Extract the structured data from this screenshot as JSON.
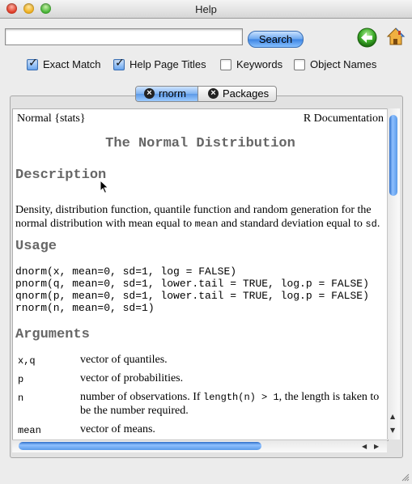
{
  "window": {
    "title": "Help"
  },
  "search": {
    "value": "",
    "button_label": "Search"
  },
  "options": [
    {
      "label": "Exact Match",
      "checked": true
    },
    {
      "label": "Help Page Titles",
      "checked": true
    },
    {
      "label": "Keywords",
      "checked": false
    },
    {
      "label": "Object Names",
      "checked": false
    }
  ],
  "tabs": [
    {
      "label": "rnorm",
      "selected": true
    },
    {
      "label": "Packages",
      "selected": false
    }
  ],
  "doc": {
    "header_left": "Normal {stats}",
    "header_right": "R Documentation",
    "title": "The Normal Distribution",
    "description_heading": "Description",
    "description_1": "Density, distribution function, quantile function and random generation for the",
    "description_2a": "normal distribution with mean equal to ",
    "description_2b": "mean",
    "description_2c": " and standard deviation equal to ",
    "description_2d": "sd",
    "description_2e": ".",
    "usage_heading": "Usage",
    "usage_lines": [
      "dnorm(x, mean=0, sd=1, log = FALSE)",
      "pnorm(q, mean=0, sd=1, lower.tail = TRUE, log.p = FALSE)",
      "qnorm(p, mean=0, sd=1, lower.tail = TRUE, log.p = FALSE)",
      "rnorm(n, mean=0, sd=1)"
    ],
    "arguments_heading": "Arguments",
    "arguments": [
      {
        "name": "x,q",
        "desc": "vector of quantiles."
      },
      {
        "name": "p",
        "desc": "vector of probabilities."
      },
      {
        "name": "n",
        "desc_a": "number of observations. If ",
        "desc_code": "length(n) > 1",
        "desc_b": ", the length is taken to",
        "desc_2": "be the number required."
      },
      {
        "name": "mean",
        "desc": "vector of means."
      }
    ]
  }
}
